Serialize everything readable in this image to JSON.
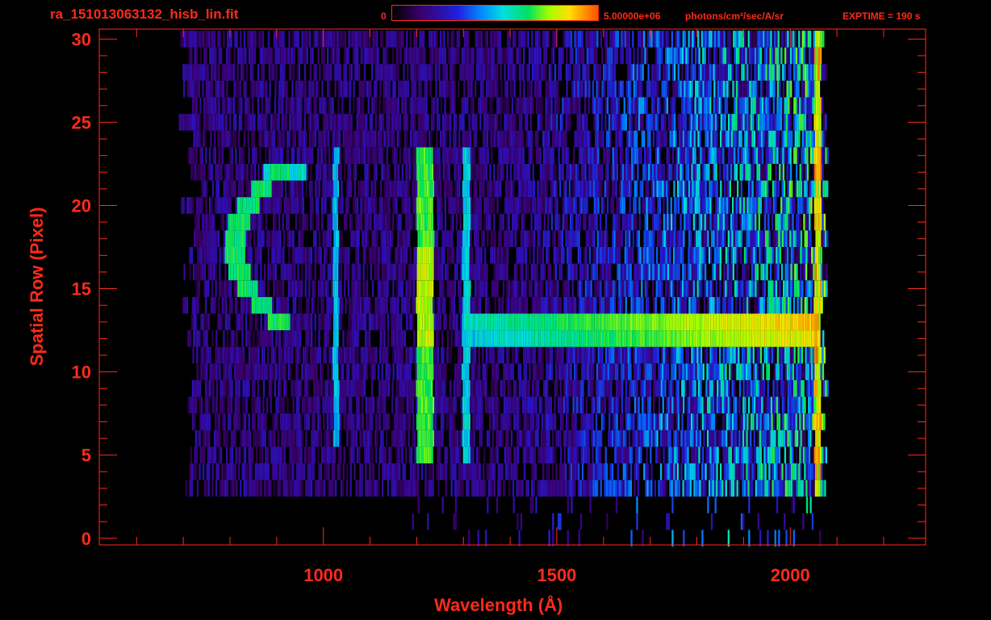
{
  "header": {
    "filename": "ra_151013063132_hisb_lin.fit",
    "colorbar_min": "0",
    "colorbar_max": "5.00000e+06",
    "colorbar_unit": "photons/cm²/sec/A/sr",
    "exptime": "EXPTIME = 190 s"
  },
  "colors": {
    "axis": "#ff2a1a",
    "background": "#000000"
  },
  "chart_data": {
    "type": "heatmap",
    "xlabel": "Wavelength (Å)",
    "ylabel": "Spatial Row (Pixel)",
    "xlim": [
      520,
      2290
    ],
    "ylim": [
      -0.4,
      30.6
    ],
    "xticks": [
      1000,
      1500,
      2000
    ],
    "yticks": [
      0,
      5,
      10,
      15,
      20,
      25,
      30
    ],
    "x_minor_step": 100,
    "y_minor_step": 1,
    "data_x_range": [
      690,
      2090
    ],
    "data_rows": [
      0,
      30
    ],
    "colorbar_range": [
      0,
      5000000
    ],
    "colormap": "rainbow",
    "features": [
      {
        "name": "Lyman-alpha",
        "wavelength": 1216,
        "rows": [
          5,
          23
        ]
      },
      {
        "name": "line",
        "wavelength": 1304,
        "rows": [
          5,
          23
        ]
      },
      {
        "name": "line",
        "wavelength": 1025,
        "rows": [
          5,
          23
        ]
      },
      {
        "name": "arc",
        "wavelength": 850,
        "rows": [
          13,
          22
        ]
      },
      {
        "name": "continuum",
        "wavelength_range": [
          1300,
          2060
        ],
        "rows": [
          12,
          13
        ]
      }
    ]
  }
}
